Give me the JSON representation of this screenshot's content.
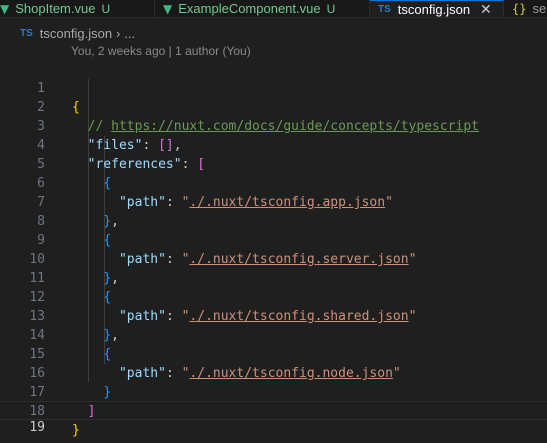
{
  "tabs": [
    {
      "name": "ShopItem.vue",
      "badge": "U"
    },
    {
      "name": "ExampleComponent.vue",
      "badge": "U"
    },
    {
      "name": "tsconfig.json",
      "close": "✕"
    },
    {
      "name": "se"
    }
  ],
  "breadcrumb": {
    "file": "tsconfig.json",
    "more": "..."
  },
  "codelens": "You, 2 weeks ago | 1 author (You)",
  "editor": {
    "line_numbers": [
      "1",
      "2",
      "3",
      "4",
      "5",
      "6",
      "7",
      "8",
      "9",
      "10",
      "11",
      "12",
      "13",
      "14",
      "15",
      "16",
      "17",
      "18",
      "19"
    ],
    "comment_prefix": "// ",
    "comment_url": "https://nuxt.com/docs/guide/concepts/typescript",
    "key_files": "\"files\"",
    "key_references": "\"references\"",
    "key_path": "\"path\"",
    "paths": [
      "./.nuxt/tsconfig.app.json",
      "./.nuxt/tsconfig.server.json",
      "./.nuxt/tsconfig.shared.json",
      "./.nuxt/tsconfig.node.json"
    ]
  },
  "colors": {
    "background": "#1f1f1f",
    "key": "#9cdcfe",
    "string": "#ce9178",
    "comment": "#6a9955",
    "bracket_gold": "#ffd700",
    "bracket_pink": "#da70d6",
    "bracket_blue": "#179fff"
  }
}
